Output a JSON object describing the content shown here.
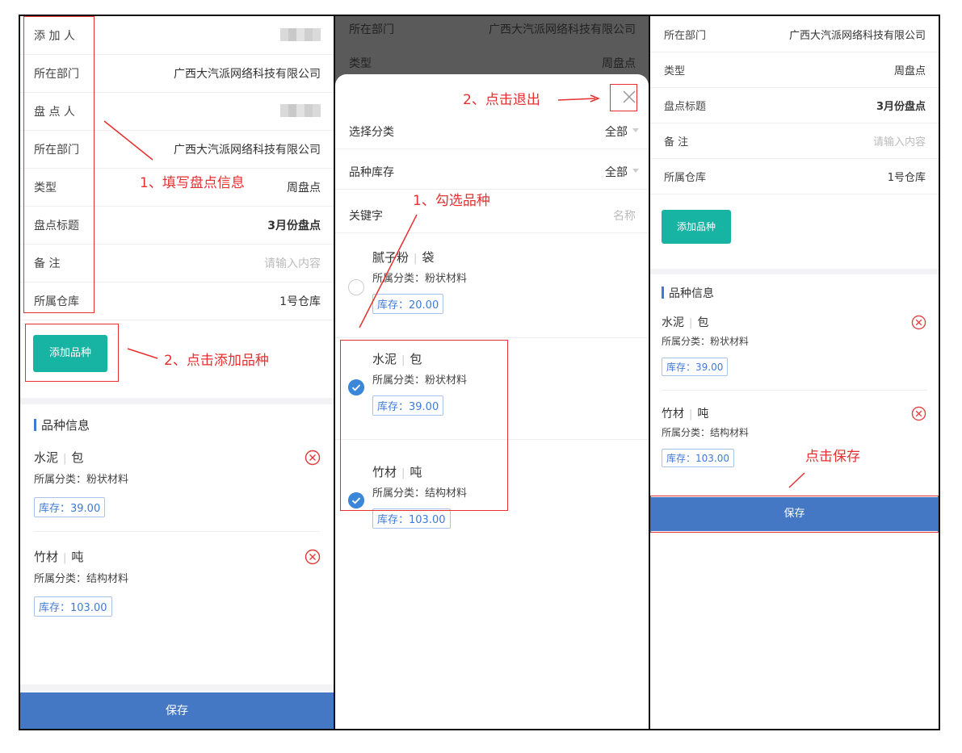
{
  "panel1": {
    "fields": [
      {
        "label": "添 加 人",
        "value": ""
      },
      {
        "label": "所在部门",
        "value": "广西大汽派网络科技有限公司"
      },
      {
        "label": "盘 点 人",
        "value": ""
      },
      {
        "label": "所在部门",
        "value": "广西大汽派网络科技有限公司"
      },
      {
        "label": "类型",
        "value": "周盘点"
      },
      {
        "label": "盘点标题",
        "value": "3月份盘点"
      },
      {
        "label": "备 注",
        "value": "",
        "placeholder": "请输入内容"
      },
      {
        "label": "所属仓库",
        "value": "1号仓库"
      }
    ],
    "add_button": "添加品种",
    "section_title": "品种信息",
    "items": [
      {
        "name": "水泥",
        "unit": "包",
        "category": "所属分类：粉状材料",
        "stock": "库存：39.00"
      },
      {
        "name": "竹材",
        "unit": "吨",
        "category": "所属分类：结构材料",
        "stock": "库存：103.00"
      }
    ],
    "save_button": "保存",
    "annotations": {
      "fill_info": "1、填写盘点信息",
      "click_add": "2、点击添加品种"
    }
  },
  "panel2": {
    "bg_rows": [
      {
        "label": "所在部门",
        "value": "广西大汽派网络科技有限公司"
      },
      {
        "label": "类型",
        "value": "周盘点"
      }
    ],
    "filters": [
      {
        "label": "选择分类",
        "value": "全部"
      },
      {
        "label": "品种库存",
        "value": "全部"
      }
    ],
    "keyword": {
      "label": "关键字",
      "placeholder": "名称"
    },
    "products": [
      {
        "name": "腻子粉",
        "unit": "袋",
        "category": "所属分类：粉状材料",
        "stock": "库存：20.00",
        "checked": false
      },
      {
        "name": "水泥",
        "unit": "包",
        "category": "所属分类：粉状材料",
        "stock": "库存：39.00",
        "checked": true
      },
      {
        "name": "竹材",
        "unit": "吨",
        "category": "所属分类：结构材料",
        "stock": "库存：103.00",
        "checked": true
      }
    ],
    "annotations": {
      "select": "1、勾选品种",
      "exit": "2、点击退出"
    }
  },
  "panel3": {
    "fields": [
      {
        "label": "所在部门",
        "value": "广西大汽派网络科技有限公司"
      },
      {
        "label": "类型",
        "value": "周盘点"
      },
      {
        "label": "盘点标题",
        "value": "3月份盘点"
      },
      {
        "label": "备 注",
        "value": "",
        "placeholder": "请输入内容"
      },
      {
        "label": "所属仓库",
        "value": "1号仓库"
      }
    ],
    "add_button": "添加品种",
    "section_title": "品种信息",
    "items": [
      {
        "name": "水泥",
        "unit": "包",
        "category": "所属分类：粉状材料",
        "stock": "库存：39.00"
      },
      {
        "name": "竹材",
        "unit": "吨",
        "category": "所属分类：结构材料",
        "stock": "库存：103.00"
      }
    ],
    "save_button": "保存",
    "annotations": {
      "click_save": "点击保存"
    }
  },
  "colors": {
    "teal": "#17b3a3",
    "blue": "#4478c4",
    "check": "#3a86d9",
    "annotation_red": "#e63030",
    "delete_red": "#e03a3a"
  }
}
